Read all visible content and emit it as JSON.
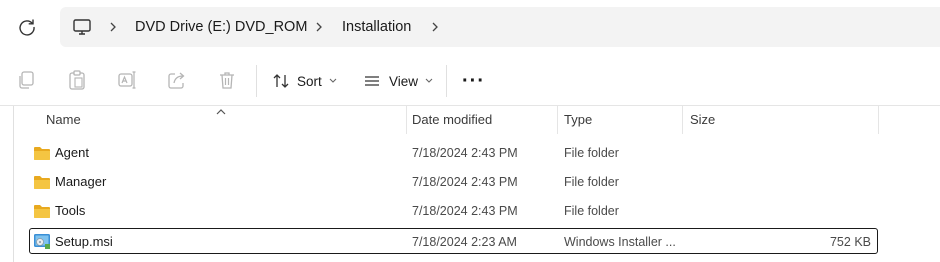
{
  "address": {
    "breadcrumbs": [
      {
        "label": "DVD Drive (E:) DVD_ROM"
      },
      {
        "label": "Installation"
      }
    ],
    "icons": {
      "refresh": "refresh-icon",
      "computer": "computer-icon",
      "separator": "chevron-right-icon"
    }
  },
  "toolbar": {
    "sort_label": "Sort",
    "view_label": "View",
    "more_label": "···",
    "icons": [
      "copy-icon",
      "paste-icon",
      "rename-icon",
      "share-icon",
      "delete-icon"
    ]
  },
  "columns": {
    "name": "Name",
    "date": "Date modified",
    "type": "Type",
    "size": "Size",
    "sorted_by": "name"
  },
  "files": [
    {
      "name": "Agent",
      "date": "7/18/2024 2:43 PM",
      "type": "File folder",
      "size": "",
      "icon": "folder-icon"
    },
    {
      "name": "Manager",
      "date": "7/18/2024 2:43 PM",
      "type": "File folder",
      "size": "",
      "icon": "folder-icon"
    },
    {
      "name": "Tools",
      "date": "7/18/2024 2:43 PM",
      "type": "File folder",
      "size": "",
      "icon": "folder-icon"
    },
    {
      "name": "Setup.msi",
      "date": "7/18/2024 2:23 AM",
      "type": "Windows Installer ...",
      "size": "752 KB",
      "icon": "msi-installer-icon",
      "focused": true
    }
  ],
  "colors": {
    "folder": "#f4c542",
    "accent": "#1a1a1a",
    "divider": "#e5e5e5"
  }
}
